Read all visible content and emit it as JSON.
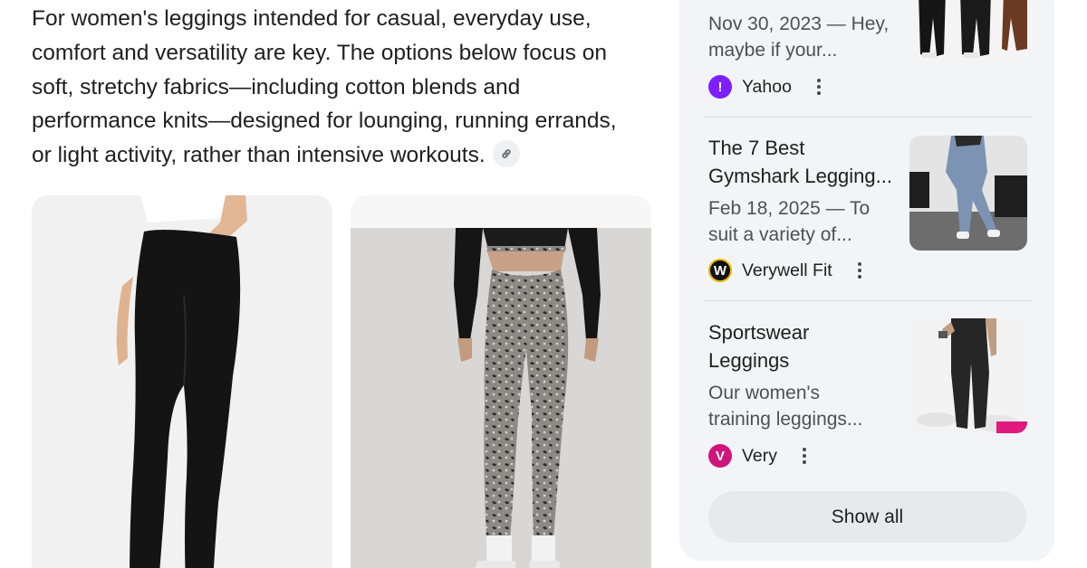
{
  "intro": {
    "line1": "For women's leggings intended for casual, everyday use,",
    "line2": "comfort and versatility are key. The options below focus on",
    "line3": "soft, stretchy fabrics—including cotton blends and",
    "line4": "performance knits—designed for lounging, running errands,",
    "line5": "or light activity, rather than intensive workouts."
  },
  "products": [
    {
      "icon": "black-leggings-photo"
    },
    {
      "icon": "leopard-leggings-photo"
    }
  ],
  "sources": {
    "items": [
      {
        "snippet_line1": "Nov 30, 2023 — Hey,",
        "snippet_line2": "maybe if your...",
        "source": "Yahoo",
        "logo_color": "#7e1fff"
      },
      {
        "title_line1": "The 7 Best",
        "title_line2": "Gymshark Legging...",
        "snippet_line1": "Feb 18, 2025 — To",
        "snippet_line2": "suit a variety of...",
        "source": "Verywell Fit",
        "logo_color": "#111111"
      },
      {
        "title_line1": "Sportswear",
        "title_line2": "Leggings",
        "snippet_line1": "Our women's",
        "snippet_line2": "training leggings...",
        "source": "Very",
        "logo_color": "#d0157a"
      }
    ],
    "show_all": "Show all"
  },
  "colors": {
    "panel_bg": "#f3f4f7",
    "button_bg": "#e7e9ed",
    "text": "#1f1f1f",
    "snippet": "#4d5156"
  }
}
